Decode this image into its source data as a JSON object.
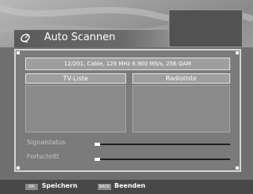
{
  "header": {
    "title": "Auto Scannen",
    "icon": "satellite-dish-icon"
  },
  "scan": {
    "info": "12/201, Cable, 129 MHz 6.900 MS/s, 256 QAM",
    "tv_list_label": "TV-Liste",
    "radio_list_label": "Radioliste",
    "signal_label": "Signalstatus",
    "progress_label": "Fortschritt",
    "signal_level": 0.04,
    "progress_level": 0.04
  },
  "footer": {
    "ok_key": "OK",
    "save_label": "Speichern",
    "back_key": "BACK",
    "exit_label": "Beenden"
  },
  "colors": {
    "panel": "#7b7b7b",
    "accent": "#ffffff"
  }
}
